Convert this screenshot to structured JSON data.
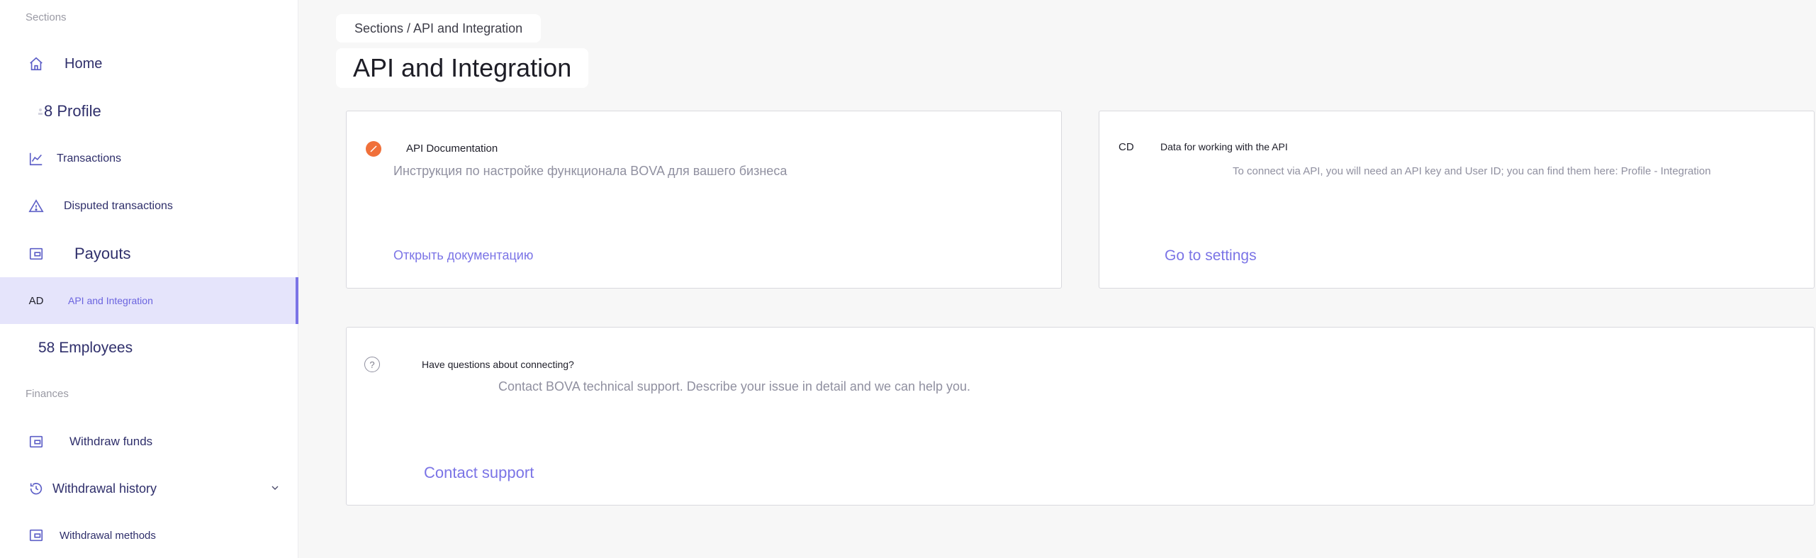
{
  "sidebar": {
    "sections_label": "Sections",
    "finances_label": "Finances",
    "items": [
      {
        "label": "Home",
        "icon": "home-icon"
      },
      {
        "label": "8 Profile",
        "icon": "profile-icon"
      },
      {
        "label": "Transactions",
        "icon": "chart-line-icon"
      },
      {
        "label": "Disputed transactions",
        "icon": "warning-icon"
      },
      {
        "label": "Payouts",
        "icon": "wallet-icon"
      },
      {
        "label": "API and Integration",
        "icon_text": "AD"
      },
      {
        "label": "58 Employees",
        "icon": "employees-icon"
      },
      {
        "label": "Withdraw funds",
        "icon": "wallet-icon"
      },
      {
        "label": "Withdrawal history",
        "icon": "history-icon"
      },
      {
        "label": "Withdrawal methods",
        "icon": "wallet-icon"
      }
    ],
    "active_item": "API and Integration"
  },
  "header": {
    "breadcrumb": "Sections / API and Integration",
    "title": "API and Integration"
  },
  "cards": {
    "docs": {
      "title": "API Documentation",
      "description": "Инструкция по настройке функционала BOVA для вашего бизнеса",
      "link": "Открыть документацию",
      "icon": "pencil-icon",
      "icon_color": "#f0703a"
    },
    "api_data": {
      "icon_text": "CD",
      "title": "Data for working with the API",
      "description": "To connect via API, you will need an API key and User ID; you can find them here: Profile - Integration",
      "link": "Go to settings"
    },
    "support": {
      "icon": "question-icon",
      "title": "Have questions about connecting?",
      "description": "Contact BOVA technical support. Describe your issue in detail and we can help you.",
      "link": "Contact support"
    }
  },
  "colors": {
    "accent": "#7b74e6",
    "active_bg": "#e5e4fb",
    "sidebar_icon": "#5d5fc7"
  }
}
